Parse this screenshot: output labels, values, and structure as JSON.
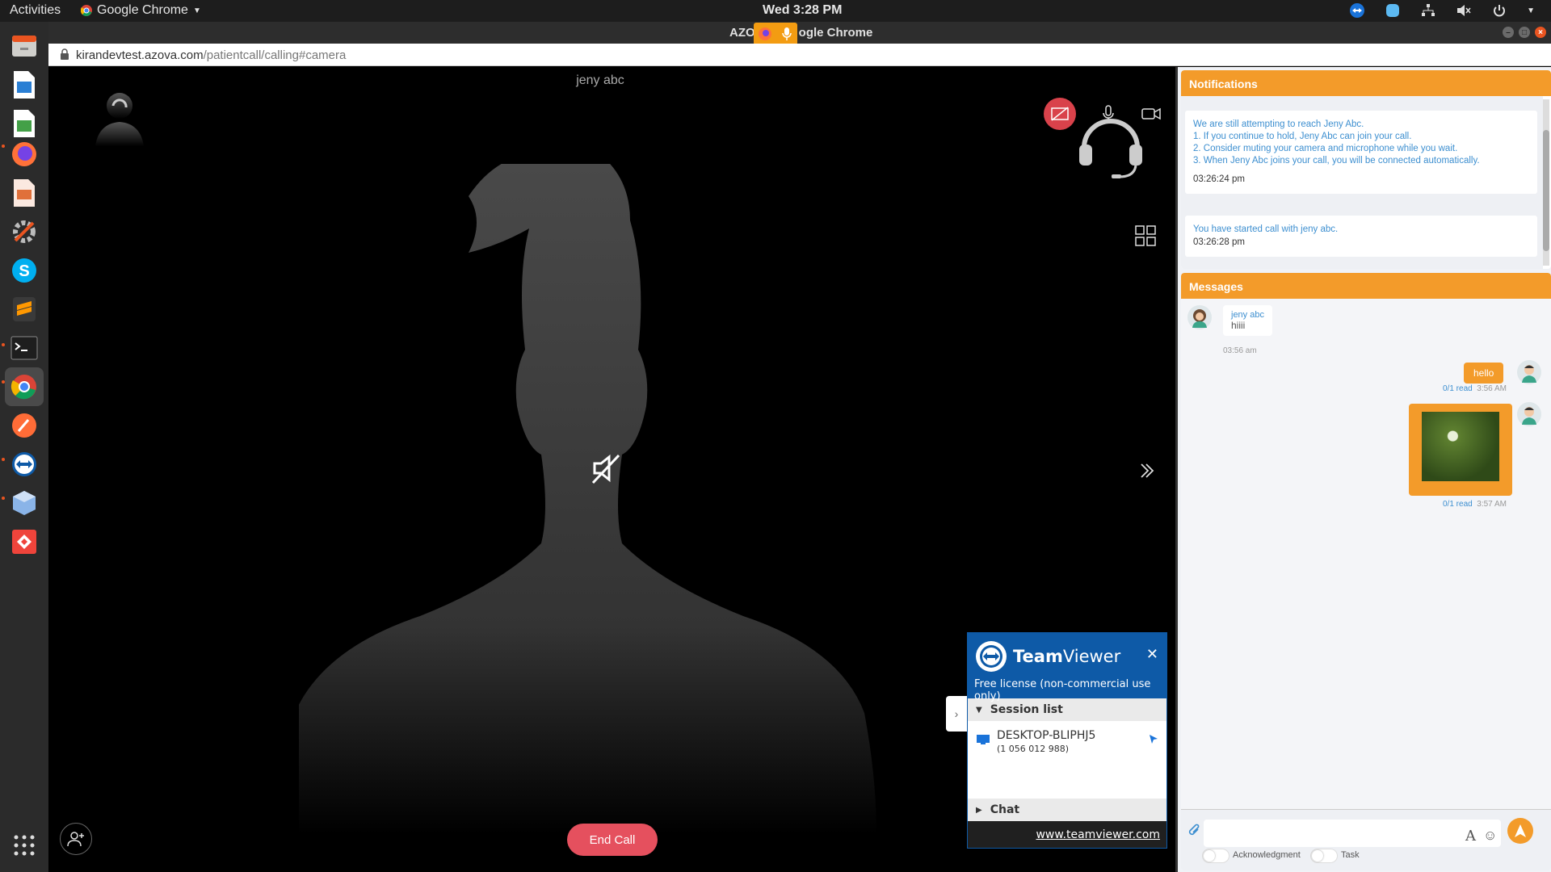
{
  "topbar": {
    "activities": "Activities",
    "app_menu": "Google Chrome",
    "clock": "Wed  3:28 PM"
  },
  "window": {
    "title_left": "AZO",
    "title_right": "ogle Chrome"
  },
  "urlbar": {
    "domain": "kirandevtest.azova.com",
    "path": "/patientcall/calling#camera"
  },
  "call": {
    "remote_name": "jeny abc",
    "end_call_label": "End Call"
  },
  "teamviewer": {
    "brand_bold": "Team",
    "brand_regular": "Viewer",
    "close": "✕",
    "license": "Free license (non-commercial use only)",
    "session_list": "Session list",
    "computer_name": "DESKTOP-BLIPHJ5",
    "computer_id": "(1 056 012 988)",
    "chat": "Chat",
    "link": "www.teamviewer.com",
    "colors": {
      "primary": "#0e5aa7"
    }
  },
  "notifications": {
    "title": "Notifications",
    "items": [
      {
        "lines": [
          "We are still attempting to reach Jeny Abc.",
          "1. If you continue to hold, Jeny Abc can join your call.",
          "2. Consider muting your camera and microphone while you wait.",
          "3. When Jeny Abc joins your call, you will be connected automatically."
        ],
        "time": "03:26:24 pm"
      },
      {
        "lines": [
          "You have started call with jeny abc."
        ],
        "time": "03:26:28 pm"
      }
    ]
  },
  "messages": {
    "title": "Messages",
    "incoming": {
      "sender": "jeny abc",
      "text": "hiiii",
      "time": "03:56 am"
    },
    "outgoing_text": {
      "text": "hello",
      "read": "0/1 read",
      "time": "3:56 AM"
    },
    "outgoing_image": {
      "read": "0/1 read",
      "time": "3:57 AM"
    }
  },
  "composer": {
    "format_icon": "A",
    "emoji_icon": "☺",
    "acknowledgment_label": "Acknowledgment",
    "task_label": "Task"
  },
  "colors": {
    "accent": "#f39b2a",
    "end_call": "#e5505e",
    "link_blue": "#3d8fd0"
  }
}
